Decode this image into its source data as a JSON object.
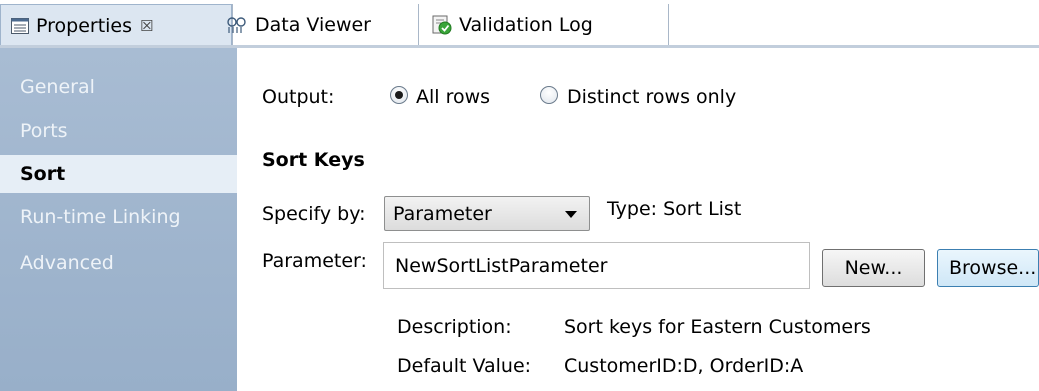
{
  "tabs": [
    {
      "label": "Properties",
      "icon": "properties-icon",
      "close": "☒",
      "active": true
    },
    {
      "label": "Data Viewer",
      "icon": "data-viewer-icon",
      "active": false
    },
    {
      "label": "Validation Log",
      "icon": "validation-log-icon",
      "active": false
    }
  ],
  "sidebar": {
    "items": [
      {
        "label": "General",
        "active": false
      },
      {
        "label": "Ports",
        "active": false
      },
      {
        "label": "Sort",
        "active": true
      },
      {
        "label": "Run-time Linking",
        "active": false
      },
      {
        "label": "Advanced",
        "active": false
      }
    ]
  },
  "output": {
    "label": "Output:",
    "options": [
      {
        "label": "All rows",
        "selected": true
      },
      {
        "label": "Distinct rows only",
        "selected": false
      }
    ]
  },
  "sort_keys": {
    "heading": "Sort Keys",
    "specify_by_label": "Specify by:",
    "specify_by_value": "Parameter",
    "type_text": "Type: Sort List",
    "parameter_label": "Parameter:",
    "parameter_value": "NewSortListParameter",
    "new_button": "New...",
    "browse_button": "Browse...",
    "description_label": "Description:",
    "description_value": "Sort keys for Eastern Customers",
    "default_value_label": "Default Value:",
    "default_value_value": "CustomerID:D, OrderID:A"
  },
  "colors": {
    "sidebar_bg": "#a8bcd3",
    "active_tab_bg": "#dce6f1",
    "focus_button": "#3c7fb1"
  }
}
